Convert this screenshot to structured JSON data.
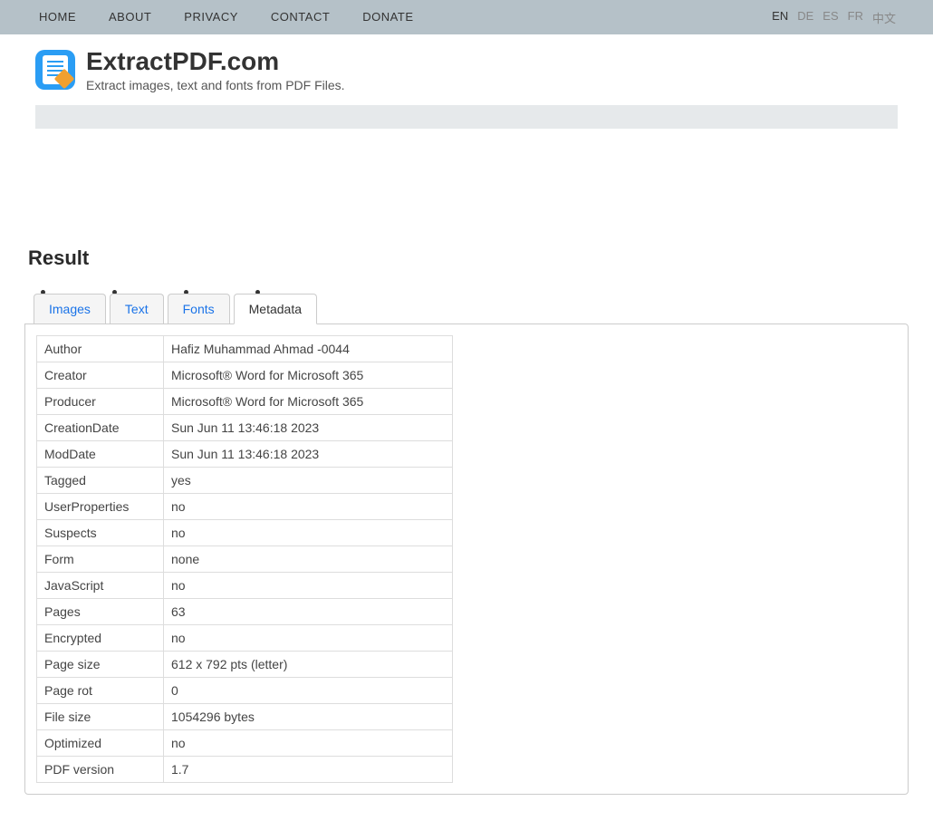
{
  "nav": {
    "items": [
      "HOME",
      "ABOUT",
      "PRIVACY",
      "CONTACT",
      "DONATE"
    ]
  },
  "lang": {
    "items": [
      "EN",
      "DE",
      "ES",
      "FR",
      "中文"
    ],
    "active": "EN"
  },
  "brand": {
    "title": "ExtractPDF.com",
    "subtitle": "Extract images, text and fonts from PDF Files."
  },
  "result": {
    "heading": "Result",
    "tabs": [
      "Images",
      "Text",
      "Fonts",
      "Metadata"
    ],
    "active_tab": "Metadata"
  },
  "metadata": [
    {
      "key": "Author",
      "value": "Hafiz Muhammad Ahmad -0044"
    },
    {
      "key": "Creator",
      "value": "Microsoft® Word for Microsoft 365"
    },
    {
      "key": "Producer",
      "value": "Microsoft® Word for Microsoft 365"
    },
    {
      "key": "CreationDate",
      "value": "Sun Jun 11 13:46:18 2023"
    },
    {
      "key": "ModDate",
      "value": "Sun Jun 11 13:46:18 2023"
    },
    {
      "key": "Tagged",
      "value": "yes"
    },
    {
      "key": "UserProperties",
      "value": "no"
    },
    {
      "key": "Suspects",
      "value": "no"
    },
    {
      "key": "Form",
      "value": "none"
    },
    {
      "key": "JavaScript",
      "value": "no"
    },
    {
      "key": "Pages",
      "value": "63"
    },
    {
      "key": "Encrypted",
      "value": "no"
    },
    {
      "key": "Page size",
      "value": "612 x 792 pts (letter)"
    },
    {
      "key": "Page rot",
      "value": "0"
    },
    {
      "key": "File size",
      "value": "1054296 bytes"
    },
    {
      "key": "Optimized",
      "value": "no"
    },
    {
      "key": "PDF version",
      "value": "1.7"
    }
  ]
}
